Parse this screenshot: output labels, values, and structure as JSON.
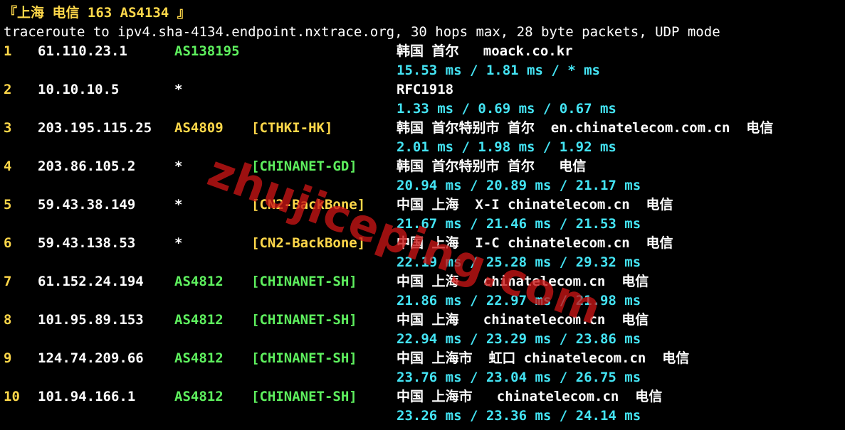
{
  "colors": {
    "background": "#000000",
    "hop_number": "#ffd84a",
    "ip": "#ffffff",
    "asn_green": "#5ef05e",
    "asn_yellow": "#ffd84a",
    "tag_yellow": "#ffd84a",
    "tag_green": "#5ef05e",
    "rtt": "#44e4f4",
    "watermark": "#c81414"
  },
  "header": {
    "title": "『上海 电信 163 AS4134 』",
    "command": "traceroute to ipv4.sha-4134.endpoint.nxtrace.org, 30 hops max, 28 byte packets, UDP mode"
  },
  "watermark": "zhujiceping.com",
  "hops": [
    {
      "n": "1",
      "ip": "61.110.23.1",
      "asn": "AS138195",
      "asn_color": "green",
      "tag": "",
      "tag_color": "",
      "geo": "韩国 首尔   moack.co.kr",
      "rtt": "15.53 ms / 1.81 ms / * ms"
    },
    {
      "n": "2",
      "ip": "10.10.10.5",
      "asn": "*",
      "asn_color": "white",
      "tag": "",
      "tag_color": "",
      "geo": "RFC1918",
      "rtt": "1.33 ms / 0.69 ms / 0.67 ms"
    },
    {
      "n": "3",
      "ip": "203.195.115.25",
      "asn": "AS4809",
      "asn_color": "yellow",
      "tag": "[CTHKI-HK]",
      "tag_color": "yellow",
      "geo": "韩国 首尔特别市 首尔  en.chinatelecom.com.cn  电信",
      "rtt": "2.01 ms / 1.98 ms / 1.92 ms"
    },
    {
      "n": "4",
      "ip": "203.86.105.2",
      "asn": "*",
      "asn_color": "white",
      "tag": "[CHINANET-GD]",
      "tag_color": "green",
      "geo": "韩国 首尔特别市 首尔   电信",
      "rtt": "20.94 ms / 20.89 ms / 21.17 ms"
    },
    {
      "n": "5",
      "ip": "59.43.38.149",
      "asn": "*",
      "asn_color": "white",
      "tag": "[CN2-BackBone]",
      "tag_color": "yellow",
      "geo": "中国 上海  X-I chinatelecom.cn  电信",
      "rtt": "21.67 ms / 21.46 ms / 21.53 ms"
    },
    {
      "n": "6",
      "ip": "59.43.138.53",
      "asn": "*",
      "asn_color": "white",
      "tag": "[CN2-BackBone]",
      "tag_color": "yellow",
      "geo": "中国 上海  I-C chinatelecom.cn  电信",
      "rtt": "22.19 ms / 25.28 ms / 29.32 ms"
    },
    {
      "n": "7",
      "ip": "61.152.24.194",
      "asn": "AS4812",
      "asn_color": "green",
      "tag": "[CHINANET-SH]",
      "tag_color": "green",
      "geo": "中国 上海   chinatelecom.cn  电信",
      "rtt": "21.86 ms / 22.97 ms / 21.98 ms"
    },
    {
      "n": "8",
      "ip": "101.95.89.153",
      "asn": "AS4812",
      "asn_color": "green",
      "tag": "[CHINANET-SH]",
      "tag_color": "green",
      "geo": "中国 上海   chinatelecom.cn  电信",
      "rtt": "22.94 ms / 23.29 ms / 23.86 ms"
    },
    {
      "n": "9",
      "ip": "124.74.209.66",
      "asn": "AS4812",
      "asn_color": "green",
      "tag": "[CHINANET-SH]",
      "tag_color": "green",
      "geo": "中国 上海市  虹口 chinatelecom.cn  电信",
      "rtt": "23.76 ms / 23.04 ms / 26.75 ms"
    },
    {
      "n": "10",
      "ip": "101.94.166.1",
      "asn": "AS4812",
      "asn_color": "green",
      "tag": "[CHINANET-SH]",
      "tag_color": "green",
      "geo": "中国 上海市   chinatelecom.cn  电信",
      "rtt": "23.26 ms / 23.36 ms / 24.14 ms"
    }
  ]
}
